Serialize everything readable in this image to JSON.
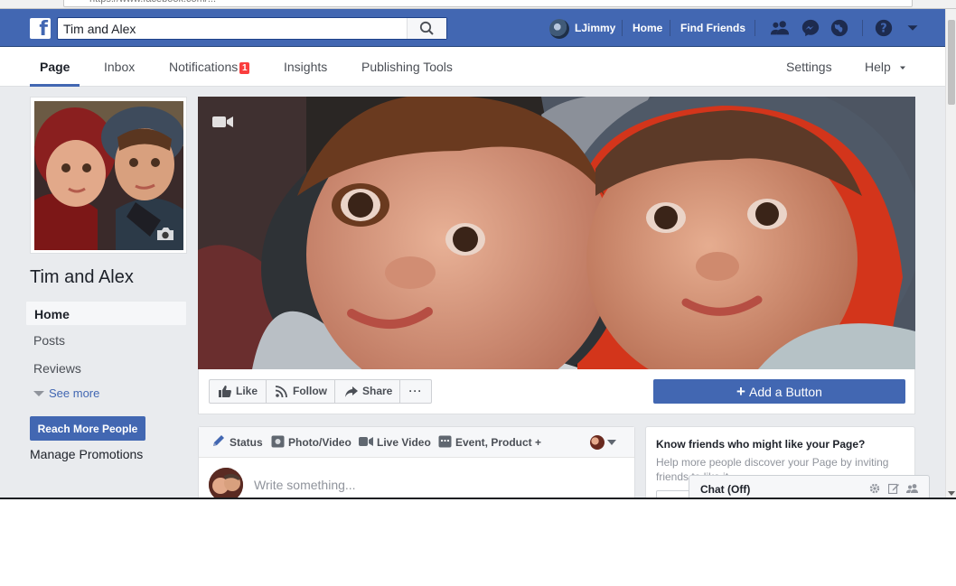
{
  "browser": {
    "url": "https://www.facebook.com/..."
  },
  "header": {
    "search": {
      "value": "Tim and Alex",
      "placeholder": "Search"
    },
    "user_name": "LJimmy",
    "nav_home": "Home",
    "nav_find_friends": "Find Friends"
  },
  "page_tabs": {
    "page": "Page",
    "inbox": "Inbox",
    "notifications": "Notifications",
    "notifications_count": "1",
    "insights": "Insights",
    "publishing_tools": "Publishing Tools",
    "settings": "Settings",
    "help": "Help"
  },
  "sidebar": {
    "page_name": "Tim and Alex",
    "items": [
      {
        "label": "Home"
      },
      {
        "label": "Posts"
      },
      {
        "label": "Reviews"
      }
    ],
    "see_more": "See more",
    "reach_button": "Reach More People",
    "manage_promotions": "Manage Promotions"
  },
  "actions": {
    "like": "Like",
    "follow": "Follow",
    "share": "Share",
    "more": "···",
    "add_button": "Add a Button"
  },
  "composer": {
    "tabs": [
      {
        "label": "Status"
      },
      {
        "label": "Photo/Video"
      },
      {
        "label": "Live Video"
      },
      {
        "label": "Event, Product +"
      }
    ],
    "placeholder": "Write something..."
  },
  "suggestions": {
    "title": "Know friends who might like your Page?",
    "subtitle": "Help more people discover your Page by inviting friends to like it."
  },
  "chat": {
    "label": "Chat (Off)"
  },
  "colors": {
    "brand_blue": "#4267b2",
    "background": "#e9ebee",
    "badge_red": "#fa3e3e"
  }
}
